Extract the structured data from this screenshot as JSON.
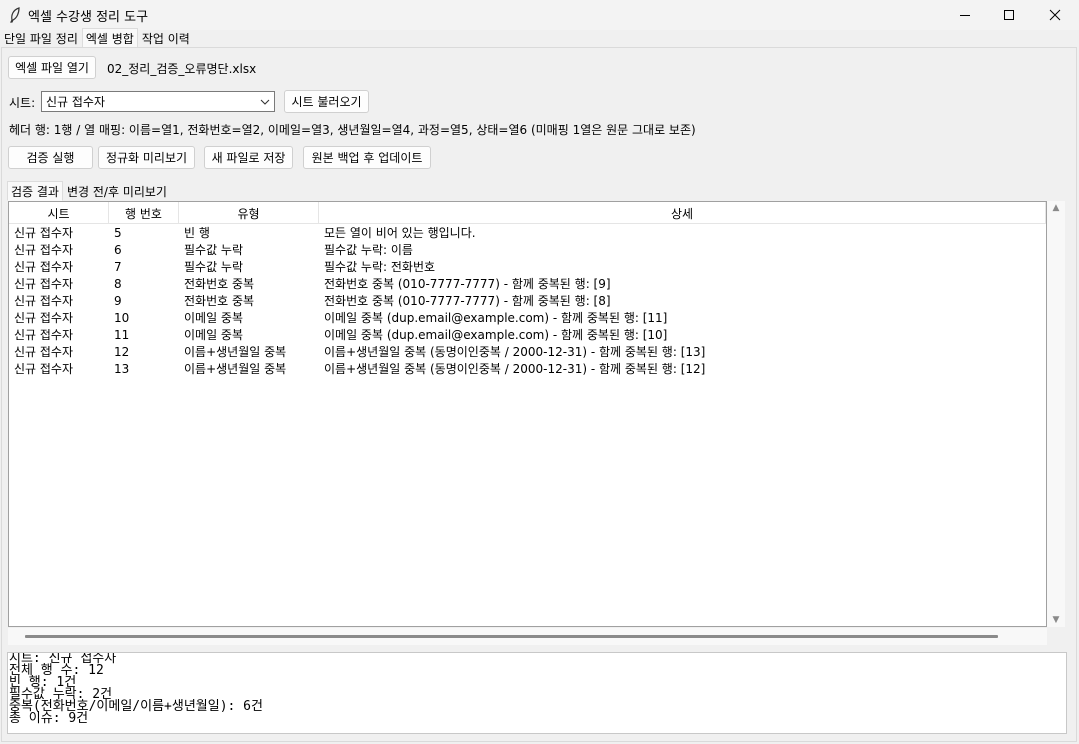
{
  "window": {
    "title": "엑셀 수강생 정리 도구"
  },
  "main_tabs": [
    {
      "label": "단일 파일 정리",
      "active": false
    },
    {
      "label": "엑셀 병합",
      "active": true
    },
    {
      "label": "작업 이력",
      "active": false
    }
  ],
  "file": {
    "open_button": "엑셀 파일 열기",
    "filename": "02_정리_검증_오류명단.xlsx"
  },
  "sheet": {
    "label": "시트:",
    "selected": "신규 접수자",
    "load_button": "시트 불러오기"
  },
  "header_mapping_text": "헤더 행: 1행 / 열 매핑: 이름=열1, 전화번호=열2, 이메일=열3, 생년월일=열4, 과정=열5, 상태=열6 (미매핑 1열은 원문 그대로 보존)",
  "actions": {
    "validate": "검증 실행",
    "normalize_preview": "정규화 미리보기",
    "save_new": "새 파일로 저장",
    "backup_update": "원본 백업 후 업데이트"
  },
  "result_tabs": [
    {
      "label": "검증 결과",
      "active": true
    },
    {
      "label": "변경 전/후 미리보기",
      "active": false
    }
  ],
  "table": {
    "columns": [
      "시트",
      "행 번호",
      "유형",
      "상세"
    ],
    "rows": [
      [
        "신규 접수자",
        "5",
        "빈 행",
        "모든 열이 비어 있는 행입니다."
      ],
      [
        "신규 접수자",
        "6",
        "필수값 누락",
        "필수값 누락: 이름"
      ],
      [
        "신규 접수자",
        "7",
        "필수값 누락",
        "필수값 누락: 전화번호"
      ],
      [
        "신규 접수자",
        "8",
        "전화번호 중복",
        "전화번호 중복 (010-7777-7777) - 함께 중복된 행: [9]"
      ],
      [
        "신규 접수자",
        "9",
        "전화번호 중복",
        "전화번호 중복 (010-7777-7777) - 함께 중복된 행: [8]"
      ],
      [
        "신규 접수자",
        "10",
        "이메일 중복",
        "이메일 중복 (dup.email@example.com) - 함께 중복된 행: [11]"
      ],
      [
        "신규 접수자",
        "11",
        "이메일 중복",
        "이메일 중복 (dup.email@example.com) - 함께 중복된 행: [10]"
      ],
      [
        "신규 접수자",
        "12",
        "이름+생년월일 중복",
        "이름+생년월일 중복 (동명이인중복 / 2000-12-31) - 함께 중복된 행: [13]"
      ],
      [
        "신규 접수자",
        "13",
        "이름+생년월일 중복",
        "이름+생년월일 중복 (동명이인중복 / 2000-12-31) - 함께 중복된 행: [12]"
      ]
    ]
  },
  "summary_lines": [
    "시트: 신규 접수자",
    "전체 행 수: 12",
    "빈 행: 1건",
    "필수값 누락: 2건",
    "중복(전화번호/이메일/이름+생년월일): 6건",
    "총 이슈: 9건"
  ]
}
